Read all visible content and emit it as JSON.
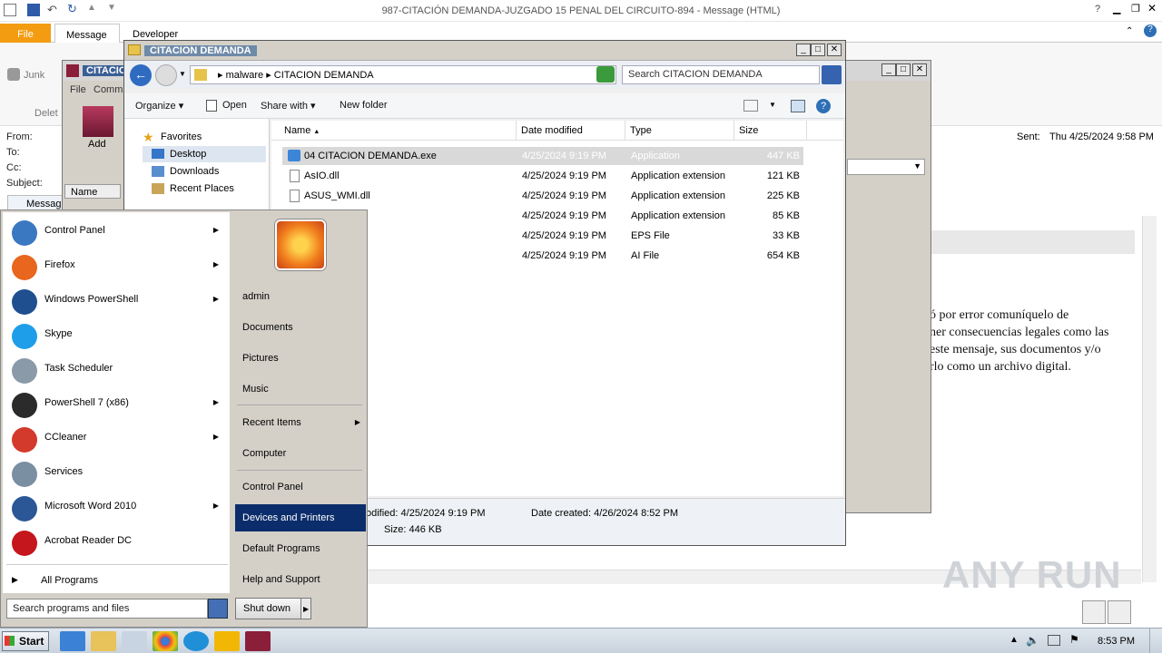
{
  "outlook": {
    "title": "987-CITACIÓN  DEMANDA-JUZGADO 15 PENAL DEL CIRCUITO-894  -  Message (HTML)",
    "tabs": [
      "File",
      "Message",
      "Developer"
    ],
    "junk_label": "Junk",
    "delete_label": "Delet",
    "header_labels": [
      "From:",
      "To:",
      "Cc:",
      "Subject:"
    ],
    "sent_label": "Sent:",
    "sent_value": "Thu 4/25/2024 9:58 PM",
    "message_tab": "Messag",
    "body_lines": [
      "ó por error comuníquelo de",
      "ner consecuencias legales como las",
      "este mensaje, sus documentos y/o",
      "rlo como un archivo digital."
    ]
  },
  "bgwin": {
    "title": "CITACIO",
    "menu": [
      "File",
      "Comm"
    ],
    "add_label": "Add",
    "name_col": "Name"
  },
  "explorer": {
    "title": "CITACION DEMANDA",
    "breadcrumb": [
      "malware",
      "CITACION DEMANDA"
    ],
    "search_placeholder": "Search CITACION DEMANDA",
    "toolbar": [
      "Organize",
      "Open",
      "Share with",
      "New folder"
    ],
    "nav": {
      "favorites": "Favorites",
      "items": [
        "Desktop",
        "Downloads",
        "Recent Places"
      ]
    },
    "columns": [
      "Name",
      "Date modified",
      "Type",
      "Size"
    ],
    "files": [
      {
        "name": "04 CITACION DEMANDA.exe",
        "date": "4/25/2024 9:19 PM",
        "type": "Application",
        "size": "447 KB",
        "selected": true
      },
      {
        "name": "AsIO.dll",
        "date": "4/25/2024 9:19 PM",
        "type": "Application extension",
        "size": "121 KB"
      },
      {
        "name": "ASUS_WMI.dll",
        "date": "4/25/2024 9:19 PM",
        "type": "Application extension",
        "size": "225 KB"
      },
      {
        "name": "",
        "date": "4/25/2024 9:19 PM",
        "type": "Application extension",
        "size": "85 KB"
      },
      {
        "name": "",
        "date": "4/25/2024 9:19 PM",
        "type": "EPS File",
        "size": "33 KB"
      },
      {
        "name": "",
        "date": "4/25/2024 9:19 PM",
        "type": "AI File",
        "size": "654 KB"
      }
    ],
    "details": {
      "modified": "odified: 4/25/2024 9:19 PM",
      "created": "Date created: 4/26/2024 8:52 PM",
      "size": "Size: 446 KB"
    }
  },
  "startmenu": {
    "left": [
      {
        "label": "Control Panel",
        "icon": "control-panel-icon",
        "arrow": true,
        "color": "#3a78c2"
      },
      {
        "label": "Firefox",
        "icon": "firefox-icon",
        "arrow": true,
        "color": "#e8661d"
      },
      {
        "label": "Windows PowerShell",
        "icon": "powershell-icon",
        "arrow": true,
        "color": "#1f4f8f"
      },
      {
        "label": "Skype",
        "icon": "skype-icon",
        "arrow": false,
        "color": "#1e9ee8"
      },
      {
        "label": "Task Scheduler",
        "icon": "task-scheduler-icon",
        "arrow": false,
        "color": "#8a9aa8"
      },
      {
        "label": "PowerShell 7 (x86)",
        "icon": "powershell7-icon",
        "arrow": true,
        "color": "#2b2b2b"
      },
      {
        "label": "CCleaner",
        "icon": "ccleaner-icon",
        "arrow": true,
        "color": "#d33a2c"
      },
      {
        "label": "Services",
        "icon": "services-icon",
        "arrow": false,
        "color": "#7b8fa3"
      },
      {
        "label": "Microsoft Word 2010",
        "icon": "word-icon",
        "arrow": true,
        "color": "#2b5797"
      },
      {
        "label": "Acrobat Reader DC",
        "icon": "acrobat-icon",
        "arrow": false,
        "color": "#c4161c"
      }
    ],
    "all_programs": "All Programs",
    "search_placeholder": "Search programs and files",
    "right": [
      "admin",
      "Documents",
      "Pictures",
      "Music",
      "Recent Items",
      "Computer",
      "Control Panel",
      "Devices and Printers",
      "Default Programs",
      "Help and Support"
    ],
    "shutdown": "Shut down"
  },
  "taskbar": {
    "start": "Start",
    "time": "8:53 PM"
  },
  "watermark": "ANY RUN"
}
